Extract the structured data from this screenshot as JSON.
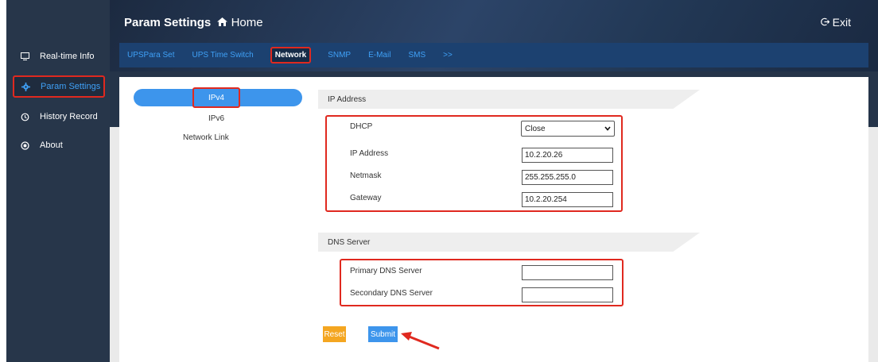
{
  "sidebar": {
    "items": [
      {
        "label": "Real-time Info",
        "icon": "monitor-icon"
      },
      {
        "label": "Param Settings",
        "icon": "gear-icon"
      },
      {
        "label": "History Record",
        "icon": "history-icon"
      },
      {
        "label": "About",
        "icon": "info-icon"
      }
    ]
  },
  "header": {
    "title": "Param Settings",
    "home": "Home",
    "exit": "Exit"
  },
  "tabs": [
    {
      "label": "UPSPara Set"
    },
    {
      "label": "UPS Time Switch"
    },
    {
      "label": "Network"
    },
    {
      "label": "SNMP"
    },
    {
      "label": "E-Mail"
    },
    {
      "label": "SMS"
    },
    {
      "label": ">>"
    }
  ],
  "subnav": [
    {
      "label": "IPv4"
    },
    {
      "label": "IPv6"
    },
    {
      "label": "Network Link"
    }
  ],
  "ip_section": {
    "title": "IP Address",
    "dhcp_label": "DHCP",
    "dhcp_value": "Close",
    "ip_label": "IP Address",
    "ip_value": "10.2.20.26",
    "netmask_label": "Netmask",
    "netmask_value": "255.255.255.0",
    "gateway_label": "Gateway",
    "gateway_value": "10.2.20.254"
  },
  "dns_section": {
    "title": "DNS Server",
    "primary_label": "Primary DNS Server",
    "primary_value": "",
    "secondary_label": "Secondary DNS Server",
    "secondary_value": ""
  },
  "buttons": {
    "reset": "Reset",
    "submit": "Submit"
  },
  "colors": {
    "accent": "#3d95ec",
    "highlight": "#e0291f",
    "reset": "#f4a621"
  }
}
